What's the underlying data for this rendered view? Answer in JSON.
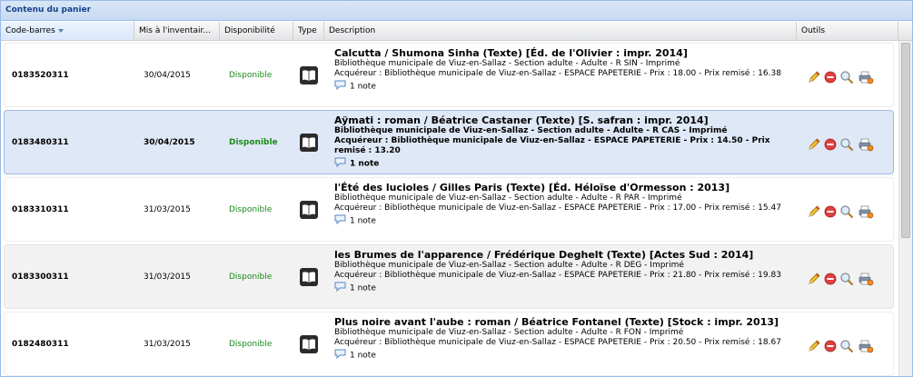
{
  "panel": {
    "title": "Contenu du panier"
  },
  "columns": {
    "barcode": "Code-barres",
    "date": "Mis à l'inventair...",
    "availability": "Disponibilité",
    "type": "Type",
    "description": "Description",
    "tools": "Outils"
  },
  "rows": [
    {
      "barcode": "0183520311",
      "date": "30/04/2015",
      "availability": "Disponible",
      "type_icon": "book-icon",
      "title": "Calcutta / Shumona Sinha (Texte) [Éd. de l'Olivier : impr. 2014]",
      "location": "Bibliothèque municipale de Viuz-en-Sallaz - Section adulte - Adulte - R SIN - Imprimé",
      "acquirer": "Acquéreur : Bibliothèque municipale de Viuz-en-Sallaz - ESPACE PAPETERIE - Prix : 18.00 - Prix remisé : 16.38",
      "notes": "1 note"
    },
    {
      "barcode": "0183480311",
      "date": "30/04/2015",
      "availability": "Disponible",
      "type_icon": "book-icon",
      "title": "Aÿmati : roman / Béatrice Castaner (Texte) [S. safran : impr. 2014]",
      "location": "Bibliothèque municipale de Viuz-en-Sallaz - Section adulte - Adulte - R CAS - Imprimé",
      "acquirer": "Acquéreur : Bibliothèque municipale de Viuz-en-Sallaz - ESPACE PAPETERIE - Prix : 14.50 - Prix remisé : 13.20",
      "notes": "1 note"
    },
    {
      "barcode": "0183310311",
      "date": "31/03/2015",
      "availability": "Disponible",
      "type_icon": "book-icon",
      "title": "l'Été des lucioles / Gilles Paris (Texte) [Éd. Héloïse d'Ormesson : 2013]",
      "location": "Bibliothèque municipale de Viuz-en-Sallaz - Section adulte - Adulte - R PAR - Imprimé",
      "acquirer": "Acquéreur : Bibliothèque municipale de Viuz-en-Sallaz - ESPACE PAPETERIE - Prix : 17.00 - Prix remisé : 15.47",
      "notes": "1 note"
    },
    {
      "barcode": "0183300311",
      "date": "31/03/2015",
      "availability": "Disponible",
      "type_icon": "book-icon",
      "title": "les Brumes de l'apparence / Frédérique Deghelt (Texte) [Actes Sud : 2014]",
      "location": "Bibliothèque municipale de Viuz-en-Sallaz - Section adulte - Adulte - R DEG - Imprimé",
      "acquirer": "Acquéreur : Bibliothèque municipale de Viuz-en-Sallaz - ESPACE PAPETERIE - Prix : 21.80 - Prix remisé : 19.83",
      "notes": "1 note"
    },
    {
      "barcode": "0182480311",
      "date": "31/03/2015",
      "availability": "Disponible",
      "type_icon": "book-icon",
      "title": "Plus noire avant l'aube : roman / Béatrice Fontanel (Texte) [Stock : impr. 2013]",
      "location": "Bibliothèque municipale de Viuz-en-Sallaz - Section adulte - Adulte - R FON - Imprimé",
      "acquirer": "Acquéreur : Bibliothèque municipale de Viuz-en-Sallaz - ESPACE PAPETERIE - Prix : 20.50 - Prix remisé : 18.67",
      "notes": "1 note"
    }
  ],
  "tools": [
    "edit-pencil-icon",
    "remove-icon",
    "search-magnifier-icon",
    "print-icon"
  ],
  "colors": {
    "header_blue": "#15428b",
    "available_green": "#1b8a1b",
    "selected_row": "#dfe8f6"
  }
}
